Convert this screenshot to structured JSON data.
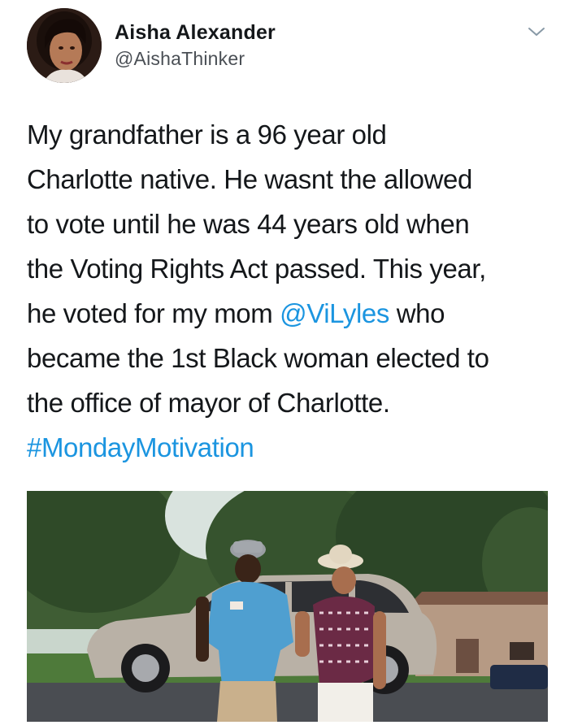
{
  "author": {
    "display_name": "Aisha Alexander",
    "handle": "@AishaThinker"
  },
  "tweet": {
    "line1": "My grandfather is a 96 year old",
    "line2": "Charlotte native. He wasnt  the allowed",
    "line3": "to vote until he was 44 years old when",
    "line4": "the Voting Rights Act passed. This year,",
    "line5_before": "he voted for my mom ",
    "mention": "@ViLyles",
    "line5_after": " who",
    "line6": "became the 1st Black woman elected to",
    "line7": "the office of mayor of Charlotte.",
    "hashtag": "#MondayMotivation"
  },
  "icons": {
    "menu": "chevron-down-icon"
  },
  "colors": {
    "link": "#1b95e0",
    "text": "#14171a",
    "handle": "#4a4f55"
  }
}
